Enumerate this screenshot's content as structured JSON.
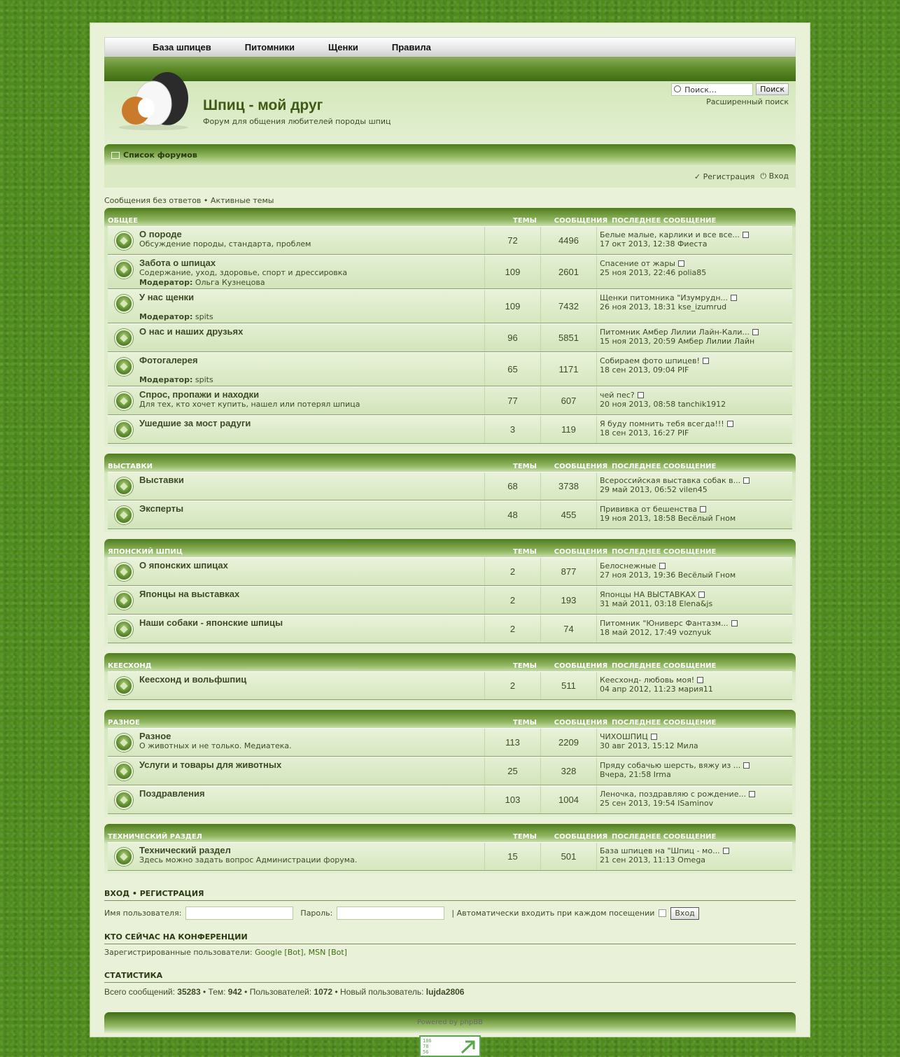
{
  "topnav": [
    "База шпицев",
    "Питомники",
    "Щенки",
    "Правила"
  ],
  "site": {
    "title": "Шпиц - мой друг",
    "description": "Форум для общения любителей породы шпиц"
  },
  "search": {
    "placeholder": "Поиск…",
    "button": "Поиск",
    "advanced": "Расширенный поиск"
  },
  "breadcrumb": "Список форумов",
  "userbar": {
    "register": "Регистрация",
    "login": "Вход"
  },
  "quicklinks": {
    "unanswered": "Сообщения без ответов",
    "sep": "•",
    "active": "Активные темы"
  },
  "headers": {
    "topics": "ТЕМЫ",
    "posts": "СООБЩЕНИЯ",
    "last": "ПОСЛЕДНЕЕ СООБЩЕНИЕ"
  },
  "categories": [
    {
      "name": "ОБЩЕЕ",
      "forums": [
        {
          "title": "О породе",
          "desc": "Обсуждение породы, стандарта, проблем",
          "mod": "",
          "topics": "72",
          "posts": "4496",
          "last_title": "Белые малые, карлики и все все...",
          "last_info": "17 окт 2013, 12:38 Фиеста"
        },
        {
          "title": "Забота о шпицах",
          "desc": "Содержание, уход, здоровье, спорт и дрессировка",
          "mod": "Ольга Кузнецова",
          "topics": "109",
          "posts": "2601",
          "last_title": "Спасение от жары",
          "last_info": "25 ноя 2013, 22:46 polia85"
        },
        {
          "title": "У нас щенки",
          "desc": "",
          "mod": "spits",
          "topics": "109",
          "posts": "7432",
          "last_title": "Щенки питомника \"Изумрудн...",
          "last_info": "26 ноя 2013, 18:31 kse_izumrud"
        },
        {
          "title": "О нас и наших друзьях",
          "desc": "",
          "mod": "",
          "topics": "96",
          "posts": "5851",
          "last_title": "Питомник Амбер Лилии Лайн-Кали...",
          "last_info": "15 ноя 2013, 20:59 Амбер Лилии Лайн"
        },
        {
          "title": "Фотогалерея",
          "desc": "",
          "mod": "spits",
          "topics": "65",
          "posts": "1171",
          "last_title": "Собираем фото шпицев!",
          "last_info": "18 сен 2013, 09:04 PIF"
        },
        {
          "title": "Спрос, пропажи и находки",
          "desc": "Для тех, кто хочет купить, нашел или потерял шпица",
          "mod": "",
          "topics": "77",
          "posts": "607",
          "last_title": "чей пес?",
          "last_info": "20 ноя 2013, 08:58 tanchik1912"
        },
        {
          "title": "Ушедшие за мост радуги",
          "desc": "",
          "mod": "",
          "topics": "3",
          "posts": "119",
          "last_title": "Я буду помнить тебя всегда!!!",
          "last_info": "18 сен 2013, 16:27 PIF"
        }
      ]
    },
    {
      "name": "ВЫСТАВКИ",
      "forums": [
        {
          "title": "Выставки",
          "desc": "",
          "mod": "",
          "topics": "68",
          "posts": "3738",
          "last_title": "Всероссийская выставка собак в...",
          "last_info": "29 май 2013, 06:52 vilen45"
        },
        {
          "title": "Эксперты",
          "desc": "",
          "mod": "",
          "topics": "48",
          "posts": "455",
          "last_title": "Прививка от бешенства",
          "last_info": "19 ноя 2013, 18:58 Весёлый Гном"
        }
      ]
    },
    {
      "name": "ЯПОНСКИЙ ШПИЦ",
      "forums": [
        {
          "title": "О японских шпицах",
          "desc": "",
          "mod": "",
          "topics": "2",
          "posts": "877",
          "last_title": "Белоснежные",
          "last_info": "27 ноя 2013, 19:36 Весёлый Гном"
        },
        {
          "title": "Японцы на выставках",
          "desc": "",
          "mod": "",
          "topics": "2",
          "posts": "193",
          "last_title": "Японцы НА ВЫСТАВКАХ",
          "last_info": "31 май 2011, 03:18 Elena&js"
        },
        {
          "title": "Наши собаки - японские шпицы",
          "desc": "",
          "mod": "",
          "topics": "2",
          "posts": "74",
          "last_title": "Питомник \"Юниверс Фантазм...",
          "last_info": "18 май 2012, 17:49 voznyuk"
        }
      ]
    },
    {
      "name": "КЕЕСХОНД",
      "forums": [
        {
          "title": "Кеесхонд и вольфшпиц",
          "desc": "",
          "mod": "",
          "topics": "2",
          "posts": "511",
          "last_title": "Кеесхонд- любовь моя!",
          "last_info": "04 апр 2012, 11:23 мария11"
        }
      ]
    },
    {
      "name": "РАЗНОЕ",
      "forums": [
        {
          "title": "Разное",
          "desc": "О животных и не только. Медиатека.",
          "mod": "",
          "topics": "113",
          "posts": "2209",
          "last_title": "ЧИХОШПИЦ",
          "last_info": "30 авг 2013, 15:12 Мила"
        },
        {
          "title": "Услуги и товары для животных",
          "desc": "",
          "mod": "",
          "topics": "25",
          "posts": "328",
          "last_title": "Пряду собачью шерсть, вяжу из ...",
          "last_info": "Вчера, 21:58 Irma"
        },
        {
          "title": "Поздравления",
          "desc": "",
          "mod": "",
          "topics": "103",
          "posts": "1004",
          "last_title": "Леночка, поздравляю с рождение...",
          "last_info": "25 сен 2013, 19:54 ISaminov"
        }
      ]
    },
    {
      "name": "ТЕХНИЧЕСКИЙ РАЗДЕЛ",
      "forums": [
        {
          "title": "Технический раздел",
          "desc": "Здесь можно задать вопрос Администрации форума.",
          "mod": "",
          "topics": "15",
          "posts": "501",
          "last_title": "База шпицев на \"Шпиц - мо...",
          "last_info": "21 сен 2013, 11:13 Omega"
        }
      ]
    }
  ],
  "moderator_label": "Модератор:",
  "loginbox": {
    "title": "ВХОД • РЕГИСТРАЦИЯ",
    "user_label": "Имя пользователя:",
    "pass_label": "Пароль:",
    "auto": "| Автоматически входить при каждом посещении",
    "button": "Вход"
  },
  "online": {
    "title": "КТО СЕЙЧАС НА КОНФЕРЕНЦИИ",
    "label": "Зарегистрированные пользователи:",
    "users": "Google [Bot], MSN [Bot]"
  },
  "stats": {
    "title": "СТАТИСТИКА",
    "l1": "Всего сообщений:",
    "v1": "35283",
    "l2": "• Тем:",
    "v2": "942",
    "l3": "• Пользователей:",
    "v3": "1072",
    "l4": "• Новый пользователь:",
    "v4": "lujda2806"
  },
  "footer": {
    "powered": "Powered by phpBB",
    "counter": [
      "186",
      "78",
      "56"
    ]
  }
}
